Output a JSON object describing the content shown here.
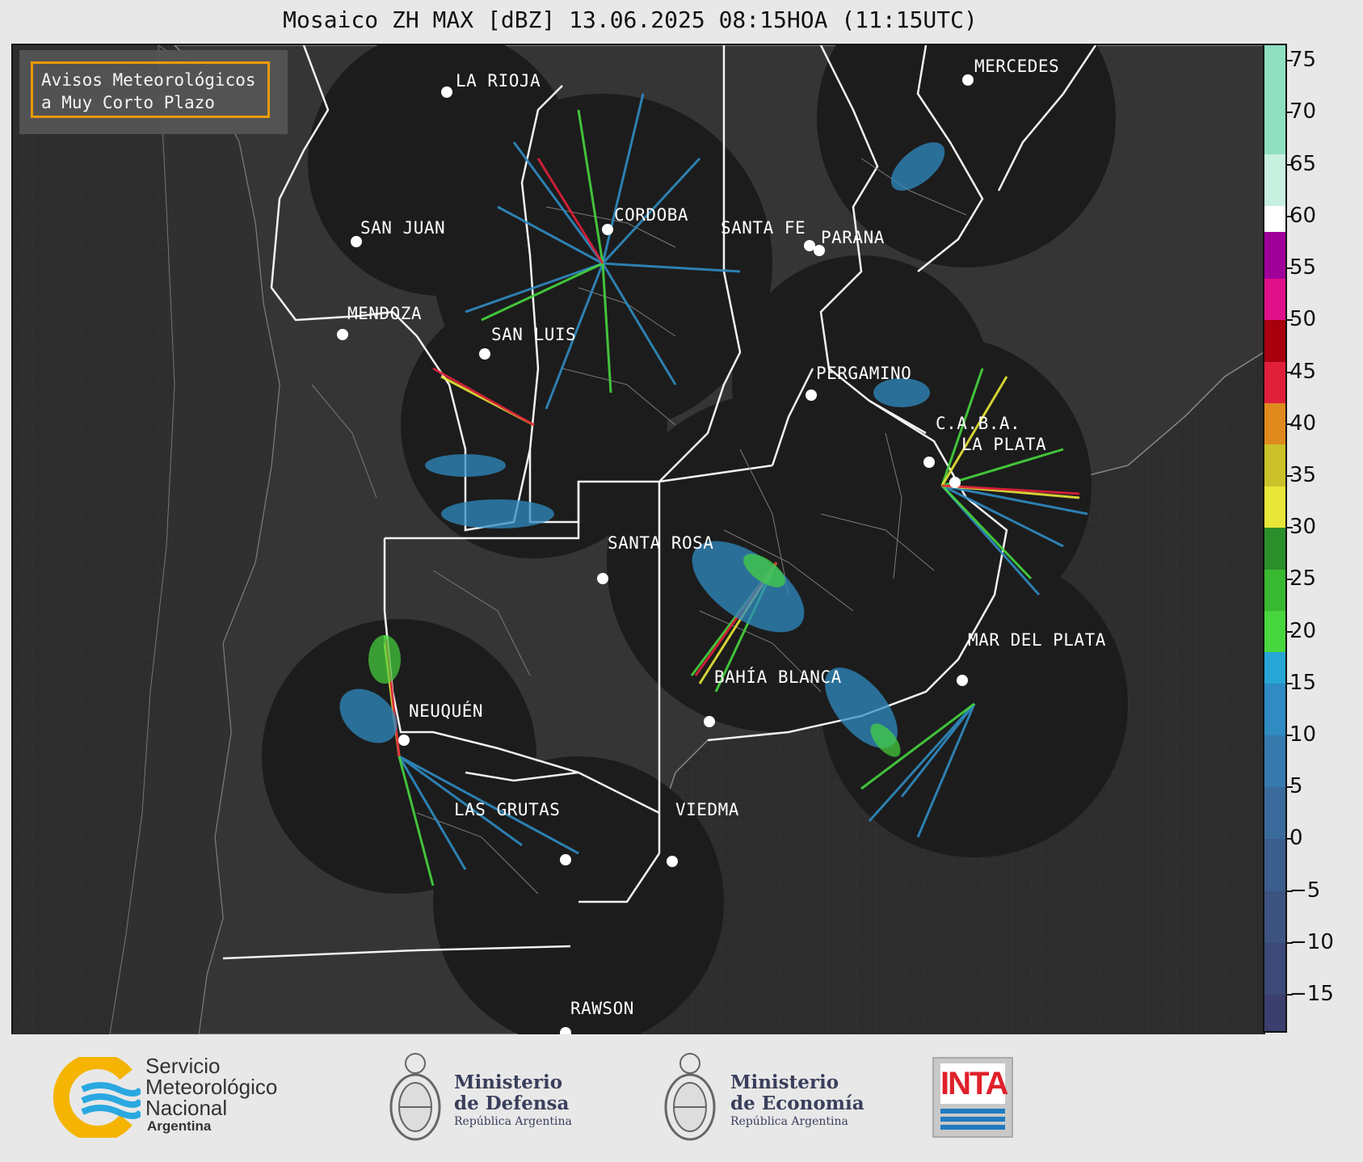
{
  "title": "Mosaico ZH MAX [dBZ] 13.06.2025 08:15HOA (11:15UTC)",
  "notice": {
    "line1": "Avisos Meteorológicos",
    "line2": "a Muy Corto Plazo"
  },
  "cities": [
    {
      "name": "LA RIOJA"
    },
    {
      "name": "CORDOBA"
    },
    {
      "name": "SAN JUAN"
    },
    {
      "name": "SANTA FE"
    },
    {
      "name": "PARANA"
    },
    {
      "name": "MERCEDES"
    },
    {
      "name": "MENDOZA"
    },
    {
      "name": "SAN LUIS"
    },
    {
      "name": "PERGAMINO"
    },
    {
      "name": "C.A.B.A."
    },
    {
      "name": "LA PLATA"
    },
    {
      "name": "SANTA ROSA"
    },
    {
      "name": "MAR DEL PLATA"
    },
    {
      "name": "BAHÍA BLANCA"
    },
    {
      "name": "NEUQUÉN"
    },
    {
      "name": "LAS GRUTAS"
    },
    {
      "name": "VIEDMA"
    },
    {
      "name": "RAWSON"
    }
  ],
  "colorbar": {
    "unit": "dBZ",
    "ticks": [
      "75",
      "70",
      "65",
      "60",
      "55",
      "50",
      "45",
      "40",
      "35",
      "30",
      "25",
      "20",
      "15",
      "10",
      "5",
      "0",
      "−5",
      "−10",
      "−15"
    ],
    "range": [
      -18.5,
      76.5
    ],
    "stops": [
      {
        "from": -18.5,
        "to": -15,
        "color": "#3b3f6e"
      },
      {
        "from": -15,
        "to": -10,
        "color": "#3d4978"
      },
      {
        "from": -10,
        "to": -5,
        "color": "#3d5380"
      },
      {
        "from": -5,
        "to": 0,
        "color": "#3c5e8c"
      },
      {
        "from": 0,
        "to": 5,
        "color": "#3a6b9c"
      },
      {
        "from": 5,
        "to": 10,
        "color": "#3679ad"
      },
      {
        "from": 10,
        "to": 15,
        "color": "#2f8bc2"
      },
      {
        "from": 15,
        "to": 18,
        "color": "#27a6d6"
      },
      {
        "from": 18,
        "to": 22,
        "color": "#47d63e"
      },
      {
        "from": 22,
        "to": 26,
        "color": "#39b832"
      },
      {
        "from": 26,
        "to": 30,
        "color": "#2a8e2a"
      },
      {
        "from": 30,
        "to": 34,
        "color": "#e8e638"
      },
      {
        "from": 34,
        "to": 38,
        "color": "#cbc22a"
      },
      {
        "from": 38,
        "to": 42,
        "color": "#e08a1e"
      },
      {
        "from": 42,
        "to": 46,
        "color": "#e0203a"
      },
      {
        "from": 46,
        "to": 50,
        "color": "#a8000e"
      },
      {
        "from": 50,
        "to": 54,
        "color": "#e0108a"
      },
      {
        "from": 54,
        "to": 58.5,
        "color": "#a0009a"
      },
      {
        "from": 58.5,
        "to": 61,
        "color": "#ffffff"
      },
      {
        "from": 61,
        "to": 66,
        "color": "#c8f0e0"
      },
      {
        "from": 66,
        "to": 76.5,
        "color": "#8ee0c0"
      }
    ]
  },
  "footer": {
    "smn_line1": "Servicio",
    "smn_line2": "Meteorológico",
    "smn_line3": "Nacional",
    "smn_line4": "Argentina",
    "defensa_line1": "Ministerio",
    "defensa_line2": "de Defensa",
    "defensa_line3": "República Argentina",
    "economia_line1": "Ministerio",
    "economia_line2": "de Economía",
    "economia_line3": "República Argentina",
    "inta": "INTA"
  }
}
